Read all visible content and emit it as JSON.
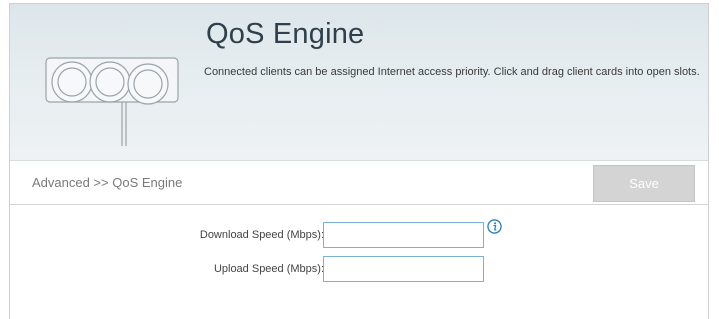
{
  "hero": {
    "title": "QoS Engine",
    "description": "Connected clients can be assigned Internet access priority. Click and drag client cards into open slots."
  },
  "breadcrumb": {
    "text": "Advanced >> QoS Engine"
  },
  "toolbar": {
    "save_label": "Save"
  },
  "form": {
    "download": {
      "label": "Download Speed (Mbps):",
      "value": ""
    },
    "upload": {
      "label": "Upload Speed (Mbps):",
      "value": ""
    }
  },
  "icons": {
    "info": "info-icon",
    "hero": "qos-router-illustration-icon"
  },
  "colors": {
    "input_border": "#7ab2d4",
    "info_icon": "#2a7fc0",
    "save_disabled": "#d4d4d4"
  }
}
